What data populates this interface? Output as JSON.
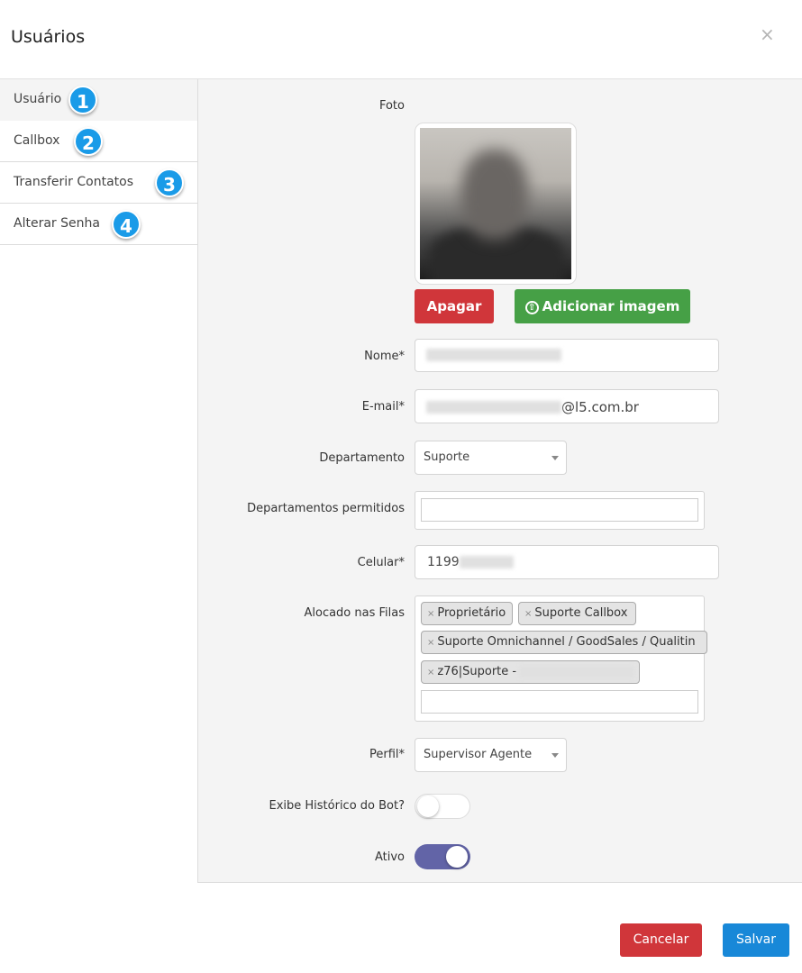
{
  "modal": {
    "title": "Usuários",
    "close_symbol": "×"
  },
  "sidebar": {
    "items": [
      {
        "label": "Usuário",
        "badge": "1"
      },
      {
        "label": "Callbox",
        "badge": "2"
      },
      {
        "label": "Transferir Contatos",
        "badge": "3"
      },
      {
        "label": "Alterar Senha",
        "badge": "4"
      }
    ]
  },
  "form": {
    "photo_label": "Foto",
    "delete_button": "Apagar",
    "add_image_button": "Adicionar imagem",
    "name_label": "Nome*",
    "email_label": "E-mail*",
    "email_suffix": "@l5.com.br",
    "department_label": "Departamento",
    "department_value": "Suporte",
    "allowed_departments_label": "Departamentos permitidos",
    "phone_label": "Celular*",
    "phone_value": "1199",
    "queues_label": "Alocado nas Filas",
    "queues": [
      "Proprietário",
      "Suporte Callbox",
      "Suporte Omnichannel / GoodSales / Qualitin",
      "z76|Suporte -"
    ],
    "profile_label": "Perfil*",
    "profile_value": "Supervisor Agente",
    "bot_history_label": "Exibe Histórico do Bot?",
    "bot_history_enabled": false,
    "active_label": "Ativo",
    "active_enabled": true
  },
  "footer": {
    "cancel_button": "Cancelar",
    "save_button": "Salvar"
  }
}
